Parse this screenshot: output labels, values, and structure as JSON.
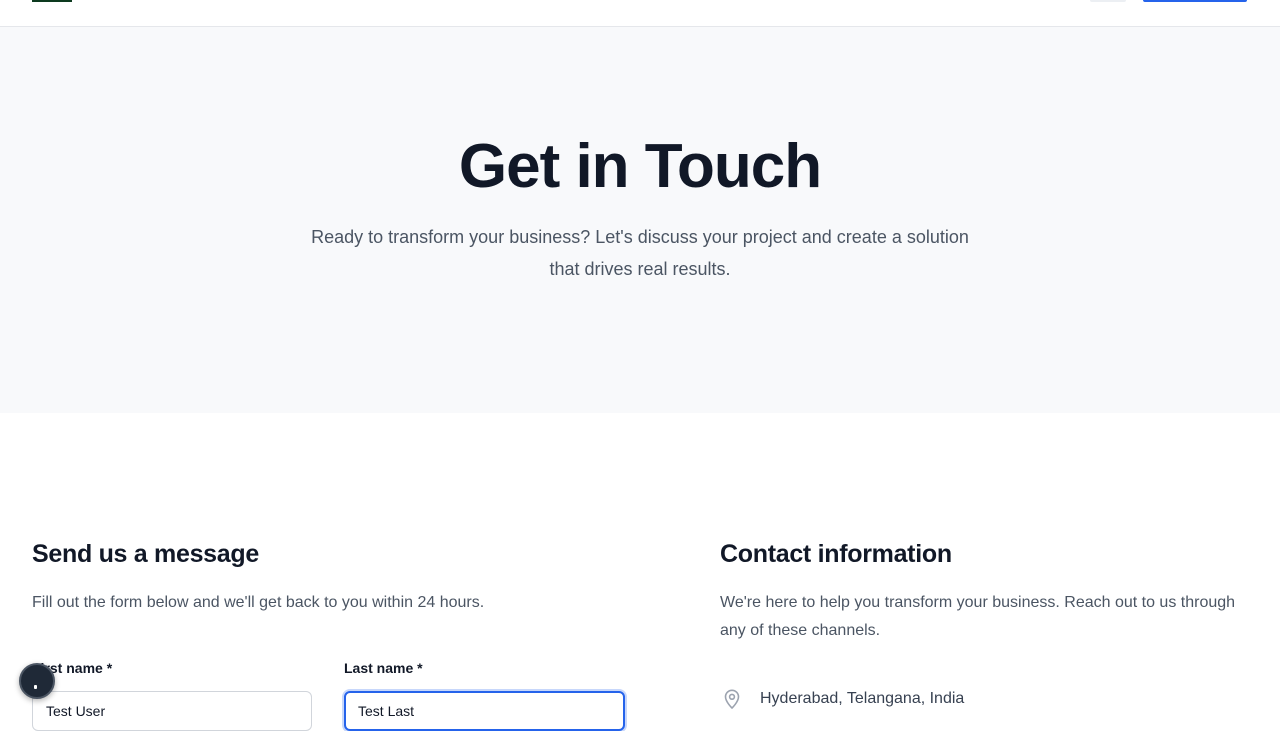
{
  "hero": {
    "title": "Get in Touch",
    "subtitle": "Ready to transform your business? Let's discuss your project and create a solution that drives real results."
  },
  "form": {
    "title": "Send us a message",
    "description": "Fill out the form below and we'll get back to you within 24 hours.",
    "first_name": {
      "label": "First name *",
      "value": "Test User"
    },
    "last_name": {
      "label": "Last name *",
      "value": "Test Last"
    }
  },
  "contact": {
    "title": "Contact information",
    "description": "We're here to help you transform your business. Reach out to us through any of these channels.",
    "location": {
      "icon": "map-pin-icon",
      "text": "Hyderabad, Telangana, India"
    }
  },
  "colors": {
    "accent": "#2563eb",
    "heading": "#111827",
    "body_text": "#4b5563",
    "hero_background": "#f8f9fb"
  }
}
